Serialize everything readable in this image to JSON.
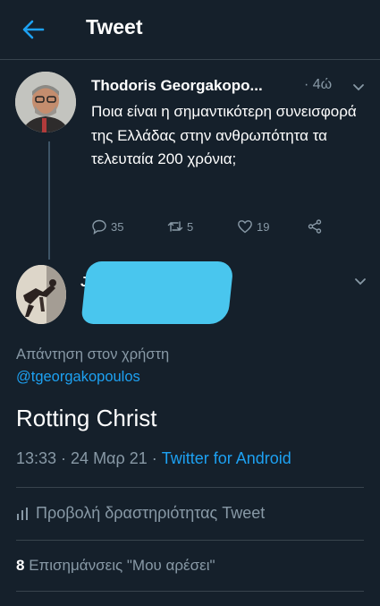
{
  "header": {
    "title": "Tweet",
    "back_icon": "arrow-left-icon"
  },
  "colors": {
    "background": "#15202b",
    "accent": "#1da1f2",
    "muted": "#8899a6",
    "divider": "#38444d"
  },
  "parent_tweet": {
    "author": "Thodoris Georgakopo...",
    "time": "· 4ώ",
    "text": "Ποια είναι η σημαντικότερη συνεισφορά της Ελλάδας στην ανθρωπότητα τα τελευταία 200 χρόνια;",
    "replies": "35",
    "retweets": "5",
    "likes": "19"
  },
  "reply": {
    "author_initial": "J",
    "reply_label": "Απάντηση στον χρήστη",
    "reply_handle": "@tgeorgakopoulos",
    "text": "Rotting Christ",
    "timestamp": "13:33 · 24 Μαρ 21 ·",
    "source": "Twitter for Android",
    "activity_label": "Προβολή δραστηριότητας Tweet",
    "likes_count": "8",
    "likes_label": "Επισημάνσεις \"Μου αρέσει\""
  }
}
